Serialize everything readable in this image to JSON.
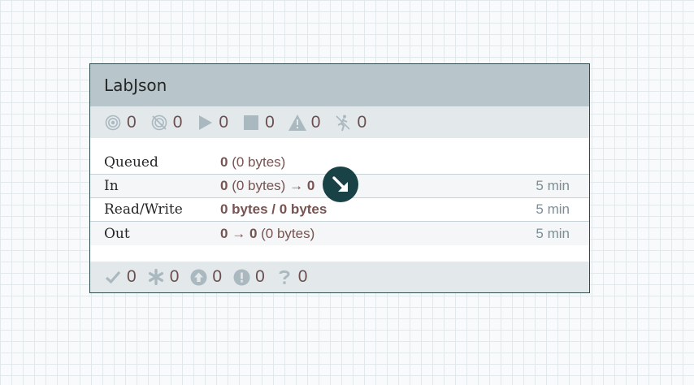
{
  "process_group": {
    "name": "LabJson",
    "counts": {
      "transmitting": "0",
      "not_transmitting": "0",
      "running": "0",
      "stopped": "0",
      "invalid": "0",
      "disabled": "0"
    },
    "stats": {
      "queued": {
        "label": "Queued",
        "count": "0",
        "size": "(0 bytes)"
      },
      "in": {
        "label": "In",
        "count": "0",
        "size": "(0 bytes)",
        "arrow": "→",
        "ports": "0",
        "time": "5 min"
      },
      "read_write": {
        "label": "Read/Write",
        "value": "0 bytes / 0 bytes",
        "time": "5 min"
      },
      "out": {
        "label": "Out",
        "ports": "0",
        "arrow": "→",
        "count": "0",
        "size": "(0 bytes)",
        "time": "5 min"
      }
    },
    "version_counts": {
      "up_to_date": "0",
      "locally_modified": "0",
      "stale": "0",
      "locally_modified_and_stale": "0",
      "sync_failure": "0"
    }
  },
  "icons": {
    "transmitting": "transmitting-icon",
    "not_transmitting": "not-transmitting-icon",
    "running": "play-icon",
    "stopped": "stop-icon",
    "invalid": "warning-icon",
    "disabled": "disabled-icon",
    "up_to_date": "check-icon",
    "locally_modified": "asterisk-icon",
    "stale": "arrow-up-circle-icon",
    "sync_failure": "exclamation-circle-icon",
    "unknown": "question-icon",
    "goto": "arrow-down-right-icon"
  },
  "colors": {
    "header": "#b8c5cb",
    "bar": "#e3e8eb",
    "border": "#2e4a4d",
    "value": "#775351",
    "icon": "#aab9c0",
    "goto": "#184245"
  }
}
